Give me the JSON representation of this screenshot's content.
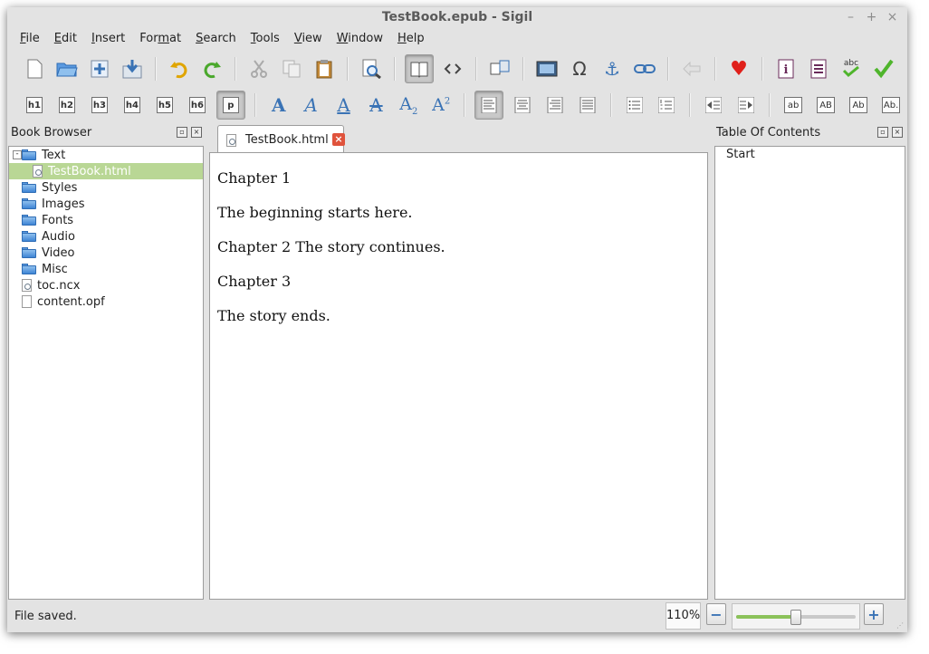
{
  "window": {
    "title": "TestBook.epub - Sigil"
  },
  "menubar": {
    "items": [
      {
        "label": "File",
        "mn": "F",
        "rest": "ile"
      },
      {
        "label": "Edit",
        "mn": "E",
        "rest": "dit"
      },
      {
        "label": "Insert",
        "mn": "I",
        "rest": "nsert"
      },
      {
        "label": "Format",
        "pre": "For",
        "mn": "m",
        "rest": "at"
      },
      {
        "label": "Search",
        "mn": "S",
        "rest": "earch"
      },
      {
        "label": "Tools",
        "mn": "T",
        "rest": "ools"
      },
      {
        "label": "View",
        "mn": "V",
        "rest": "iew"
      },
      {
        "label": "Window",
        "mn": "W",
        "rest": "indow"
      },
      {
        "label": "Help",
        "mn": "H",
        "rest": "elp"
      }
    ]
  },
  "toolbar2": {
    "headings": [
      "h1",
      "h2",
      "h3",
      "h4",
      "h5",
      "h6"
    ],
    "paragraph": "p",
    "case_buttons": [
      "ab",
      "AB",
      "Ab",
      "Ab."
    ]
  },
  "book_browser": {
    "title": "Book Browser",
    "expander": "-",
    "items": [
      {
        "label": "Text",
        "type": "folder",
        "expanded": true
      },
      {
        "label": "TestBook.html",
        "type": "html",
        "selected": true
      },
      {
        "label": "Styles",
        "type": "folder"
      },
      {
        "label": "Images",
        "type": "folder"
      },
      {
        "label": "Fonts",
        "type": "folder"
      },
      {
        "label": "Audio",
        "type": "folder"
      },
      {
        "label": "Video",
        "type": "folder"
      },
      {
        "label": "Misc",
        "type": "folder"
      },
      {
        "label": "toc.ncx",
        "type": "html"
      },
      {
        "label": "content.opf",
        "type": "file"
      }
    ]
  },
  "editor": {
    "tab_label": "TestBook.html",
    "paragraphs": [
      "Chapter 1",
      "The beginning starts here.",
      "Chapter 2 The story continues.",
      "Chapter 3",
      "The story ends."
    ]
  },
  "toc": {
    "title": "Table Of Contents",
    "entries": [
      "Start"
    ]
  },
  "status": {
    "message": "File saved.",
    "zoom": "110%",
    "zoom_fraction": 0.5
  },
  "colors": {
    "selection": "#b9d795",
    "accent_blue": "#3a73b5",
    "close_red": "#e0533c",
    "heart_red": "#e0201a",
    "check_green": "#4fb52c"
  }
}
